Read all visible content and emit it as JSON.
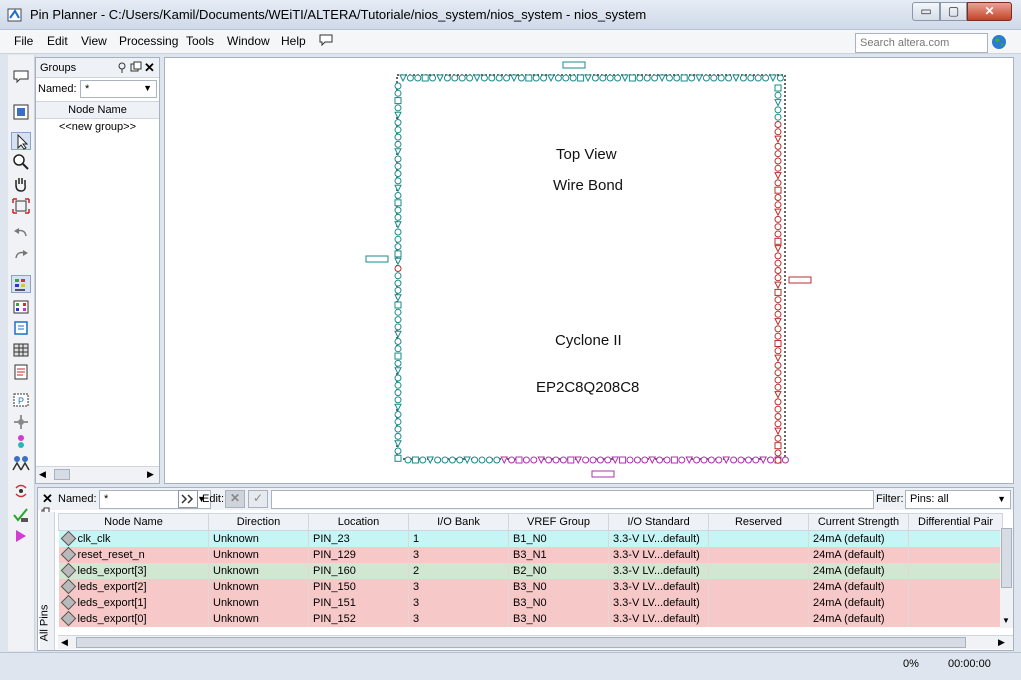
{
  "window": {
    "title": "Pin Planner - C:/Users/Kamil/Documents/WEiTI/ALTERA/Tutoriale/nios_system/nios_system - nios_system",
    "minimize_label": "▭",
    "maximize_label": "▢",
    "close_label": "✕"
  },
  "menu": [
    "File",
    "Edit",
    "View",
    "Processing",
    "Tools",
    "Window",
    "Help"
  ],
  "search": {
    "placeholder": "Search altera.com"
  },
  "groups_panel": {
    "title": "Groups",
    "named_label": "Named:",
    "named_value": "*",
    "column_header": "Node Name",
    "new_group": "<<new group>>"
  },
  "chip": {
    "view": "Top View",
    "bond": "Wire Bond",
    "family": "Cyclone II",
    "device": "EP2C8Q208C8"
  },
  "pin_panel": {
    "named_label": "Named:",
    "named_value": "*",
    "edit_label": "Edit:",
    "filter_label": "Filter:",
    "filter_value": "Pins: all",
    "tab_label": "All Pins",
    "columns": [
      "Node Name",
      "Direction",
      "Location",
      "I/O Bank",
      "VREF Group",
      "I/O Standard",
      "Reserved",
      "Current Strength",
      "Differential Pair"
    ],
    "rows": [
      [
        "clk_clk",
        "Unknown",
        "PIN_23",
        "1",
        "B1_N0",
        "3.3-V LV...default)",
        "",
        "24mA (default)",
        ""
      ],
      [
        "reset_reset_n",
        "Unknown",
        "PIN_129",
        "3",
        "B3_N1",
        "3.3-V LV...default)",
        "",
        "24mA (default)",
        ""
      ],
      [
        "leds_export[3]",
        "Unknown",
        "PIN_160",
        "2",
        "B2_N0",
        "3.3-V LV...default)",
        "",
        "24mA (default)",
        ""
      ],
      [
        "leds_export[2]",
        "Unknown",
        "PIN_150",
        "3",
        "B3_N0",
        "3.3-V LV...default)",
        "",
        "24mA (default)",
        ""
      ],
      [
        "leds_export[1]",
        "Unknown",
        "PIN_151",
        "3",
        "B3_N0",
        "3.3-V LV...default)",
        "",
        "24mA (default)",
        ""
      ],
      [
        "leds_export[0]",
        "Unknown",
        "PIN_152",
        "3",
        "B3_N0",
        "3.3-V LV...default)",
        "",
        "24mA (default)",
        ""
      ]
    ],
    "row_colors": [
      "#c5f5f5",
      "#f7c8c8",
      "#d2e7d2",
      "#f7c8c8",
      "#f7c8c8",
      "#f7c8c8"
    ]
  },
  "status": {
    "progress": "0%",
    "time": "00:00:00"
  },
  "colors": {
    "pin_outline": "#1b8b8b",
    "pin_red": "#b8302c",
    "pin_magenta": "#b030b0"
  },
  "icons": [
    "app-icon",
    "feedback-icon",
    "globe-icon",
    "select-icon",
    "zoom-icon",
    "hand-icon",
    "fit-icon",
    "undo-icon",
    "redo-icon",
    "pin-legend-icon"
  ]
}
